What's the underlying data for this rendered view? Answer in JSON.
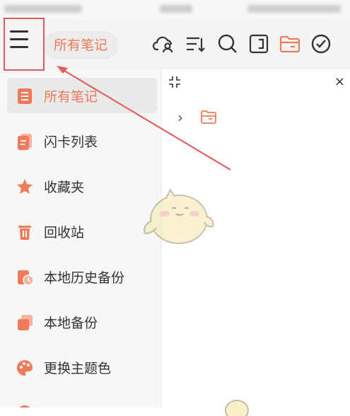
{
  "toolbar": {
    "title": "所有笔记",
    "icons": [
      "cloud-user-icon",
      "sort-icon",
      "search-icon",
      "notebook-icon",
      "folder-icon",
      "check-circle-icon"
    ]
  },
  "drawer": {
    "items": [
      {
        "label": "所有笔记",
        "icon": "note-list-icon",
        "active": true
      },
      {
        "label": "闪卡列表",
        "icon": "flashcard-icon",
        "active": false
      },
      {
        "label": "收藏夹",
        "icon": "star-icon",
        "active": false
      },
      {
        "label": "回收站",
        "icon": "trash-icon",
        "active": false
      },
      {
        "label": "本地历史备份",
        "icon": "history-backup-icon",
        "active": false
      },
      {
        "label": "本地备份",
        "icon": "local-backup-icon",
        "active": false
      },
      {
        "label": "更换主题色",
        "icon": "palette-icon",
        "active": false
      }
    ]
  },
  "main": {
    "close_label": "×"
  },
  "colors": {
    "accent": "#f07a5a",
    "annotation": "#e05a5a"
  }
}
